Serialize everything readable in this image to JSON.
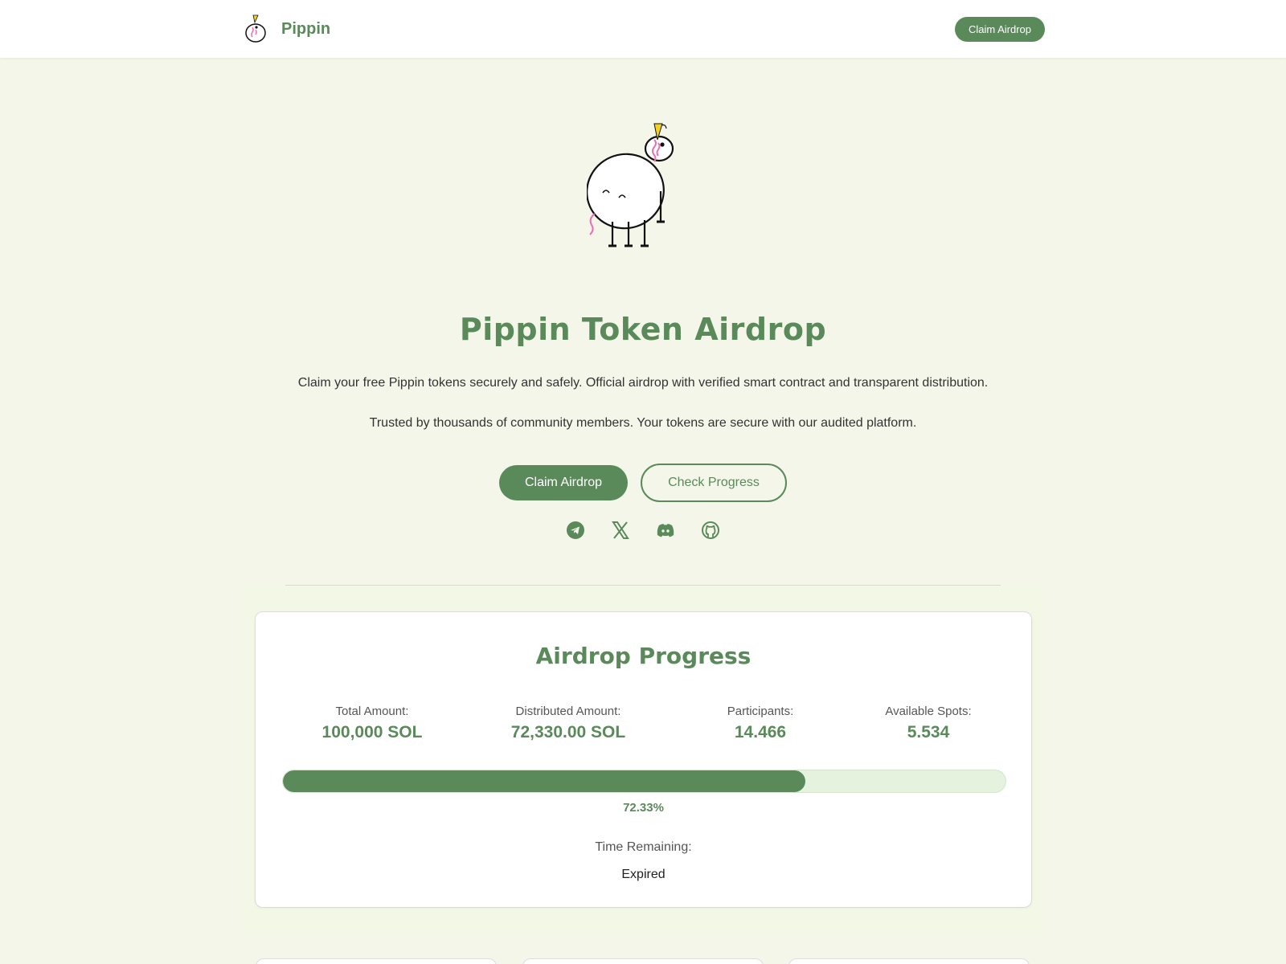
{
  "header": {
    "brand_name": "Pippin",
    "claim_button": "Claim Airdrop"
  },
  "hero": {
    "title": "Pippin Token Airdrop",
    "text1": "Claim your free Pippin tokens securely and safely. Official airdrop with verified smart contract and transparent distribution.",
    "text2": "Trusted by thousands of community members. Your tokens are secure with our audited platform.",
    "primary_button": "Claim Airdrop",
    "secondary_button": "Check Progress",
    "socials": [
      "telegram-icon",
      "x-icon",
      "discord-icon",
      "github-icon"
    ]
  },
  "progress": {
    "title": "Airdrop Progress",
    "stats": [
      {
        "label": "Total Amount:",
        "value": "100,000 SOL"
      },
      {
        "label": "Distributed Amount:",
        "value": "72,330.00 SOL"
      },
      {
        "label": "Participants:",
        "value": "14.466"
      },
      {
        "label": "Available Spots:",
        "value": "5.534"
      }
    ],
    "percent_label": "72.33%",
    "percent_value": 72.33,
    "time_label": "Time Remaining:",
    "time_value": "Expired"
  },
  "colors": {
    "accent": "#5a8a5a",
    "background": "#f4f6ea",
    "track": "#e4f2de"
  }
}
